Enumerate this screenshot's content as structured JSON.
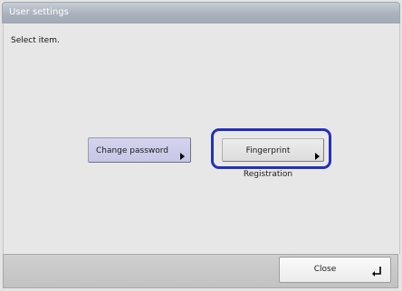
{
  "window": {
    "title": "User settings"
  },
  "main": {
    "prompt": "Select item.",
    "change_password_label": "Change password",
    "fingerprint_label": "Fingerprint Registration"
  },
  "footer": {
    "close_label": "Close"
  },
  "icons": {
    "arrow": "arrow-right-icon",
    "enter": "enter-return-icon"
  },
  "colors": {
    "focus_ring": "#2430b8",
    "change_button": "#cbcbe9"
  }
}
